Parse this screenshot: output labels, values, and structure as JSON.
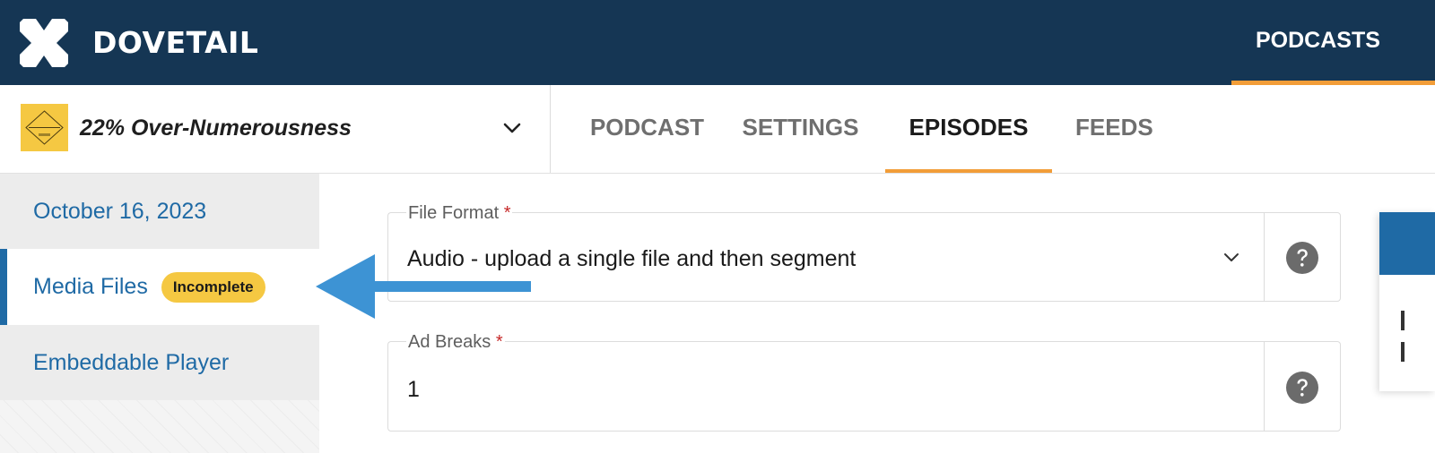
{
  "app": {
    "brand": "DOVETAIL",
    "logo_icon": "dovetail-x-logo",
    "nav_active": "PODCASTS"
  },
  "podcast": {
    "name": "22% Over-Numerousness",
    "thumbnail_icon": "podcast-cover-thumbnail"
  },
  "tabs": [
    {
      "label": "PODCAST",
      "active": false
    },
    {
      "label": "SETTINGS",
      "active": false
    },
    {
      "label": "EPISODES",
      "active": true
    },
    {
      "label": "FEEDS",
      "active": false
    }
  ],
  "sidebar": {
    "items": [
      {
        "label": "October 16, 2023",
        "active": false
      },
      {
        "label": "Media Files",
        "active": true,
        "badge": "Incomplete"
      },
      {
        "label": "Embeddable Player",
        "active": false
      }
    ]
  },
  "form": {
    "file_format": {
      "label": "File Format",
      "required_mark": "*",
      "value": "Audio - upload a single file and then segment"
    },
    "ad_breaks": {
      "label": "Ad Breaks",
      "required_mark": "*",
      "value": "1"
    }
  },
  "colors": {
    "topbar": "#153654",
    "accent_orange": "#f29d38",
    "link_blue": "#1f6aa5",
    "badge_yellow": "#f5c842",
    "annotation_arrow": "#3d93d4"
  }
}
